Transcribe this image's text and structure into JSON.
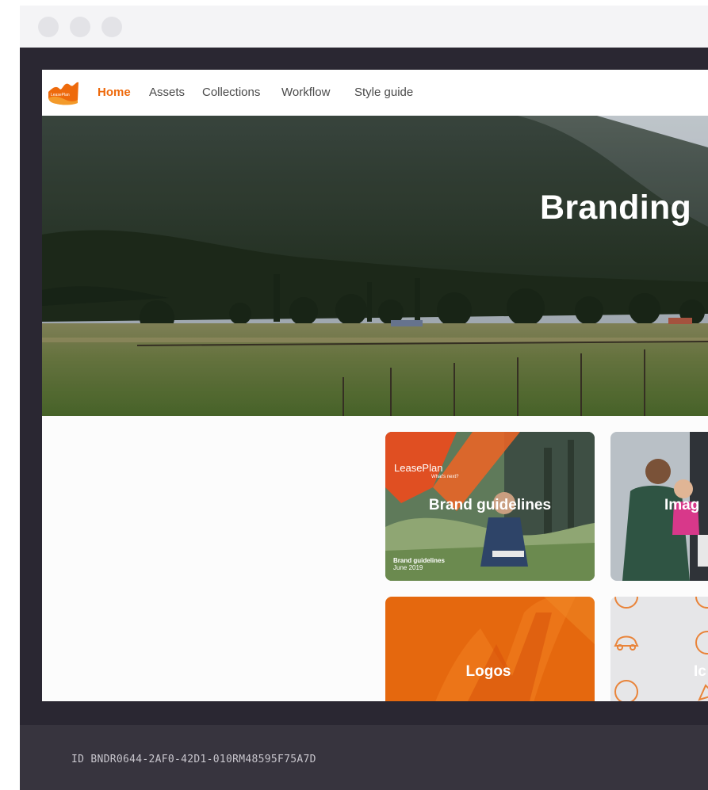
{
  "nav": {
    "logo_text": "LeasePlan",
    "items": [
      {
        "label": "Home",
        "active": true
      },
      {
        "label": "Assets",
        "active": false
      },
      {
        "label": "Collections",
        "active": false
      },
      {
        "label": "Workflow",
        "active": false
      },
      {
        "label": "Style guide",
        "active": false
      }
    ]
  },
  "hero": {
    "title": "Branding"
  },
  "cards": [
    {
      "title": "Brand guidelines",
      "brand": "LeasePlan",
      "tagline": "What's next?",
      "footnote_title": "Brand guidelines",
      "footnote_date": "June 2019"
    },
    {
      "title": "Imag"
    },
    {
      "title": "Logos"
    },
    {
      "title": "Ic"
    }
  ],
  "footer": {
    "id_text": "ID BNDR0644-2AF0-42D1-010RM48595F75A7D"
  },
  "colors": {
    "accent": "#ee6a0c",
    "window_frame": "#2a2732",
    "footer_bg": "#37343e"
  }
}
